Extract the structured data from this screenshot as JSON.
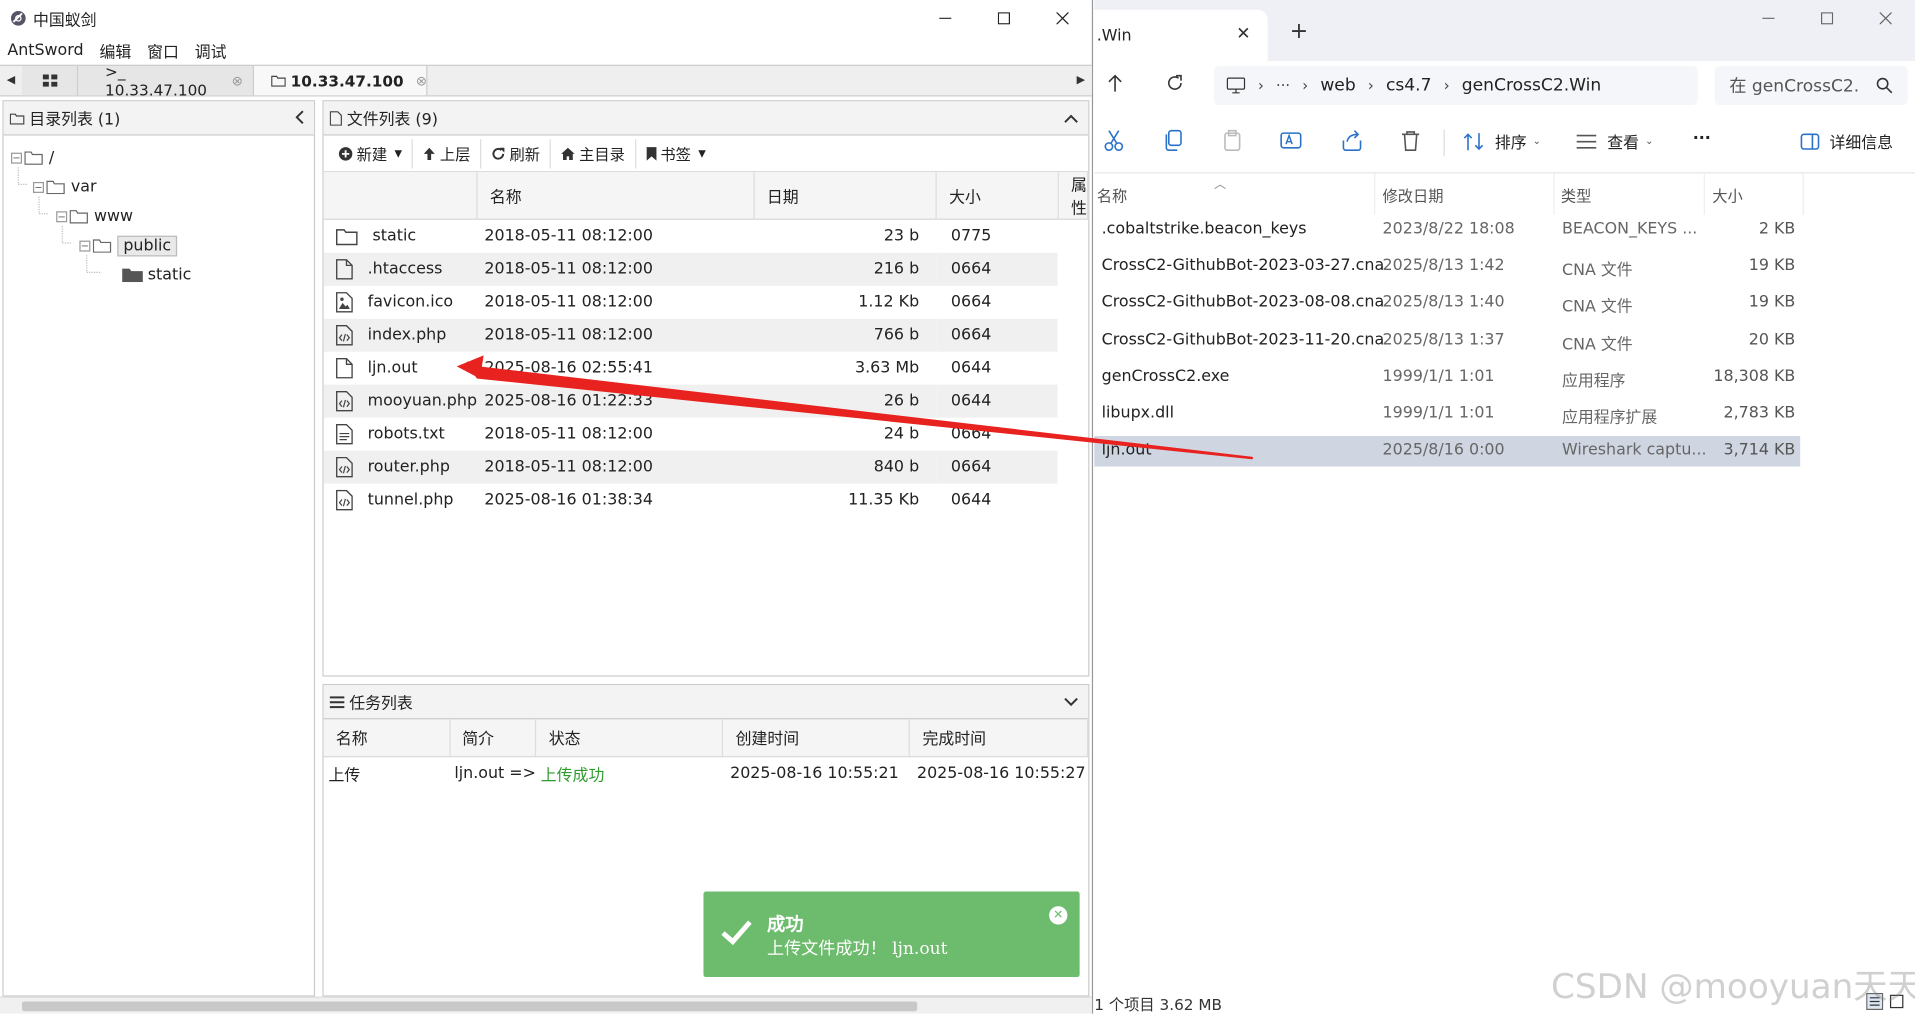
{
  "antsword": {
    "window_title": "中国蚁剑",
    "menu": [
      "AntSword",
      "编辑",
      "窗口",
      "调试"
    ],
    "tabs": [
      {
        "label": ">_ 10.33.47.100"
      },
      {
        "label": "10.33.47.100"
      }
    ],
    "dir_panel_title": "目录列表 (1)",
    "tree": [
      "/",
      "var",
      "www",
      "public",
      "static"
    ],
    "file_panel_title": "文件列表 (9)",
    "toolbar": {
      "new": "新建",
      "up": "上层",
      "refresh": "刷新",
      "home": "主目录",
      "bookmark": "书签"
    },
    "file_columns": [
      "名称",
      "日期",
      "大小",
      "属性"
    ],
    "files": [
      {
        "icon": "folder",
        "name": "static",
        "date": "2018-05-11 08:12:00",
        "size": "23 b",
        "perm": "0775"
      },
      {
        "icon": "file",
        "name": ".htaccess",
        "date": "2018-05-11 08:12:00",
        "size": "216 b",
        "perm": "0664"
      },
      {
        "icon": "image",
        "name": "favicon.ico",
        "date": "2018-05-11 08:12:00",
        "size": "1.12 Kb",
        "perm": "0664"
      },
      {
        "icon": "code",
        "name": "index.php",
        "date": "2018-05-11 08:12:00",
        "size": "766 b",
        "perm": "0664"
      },
      {
        "icon": "file",
        "name": "ljn.out",
        "date": "2025-08-16 02:55:41",
        "size": "3.63 Mb",
        "perm": "0644"
      },
      {
        "icon": "code",
        "name": "mooyuan.php",
        "date": "2025-08-16 01:22:33",
        "size": "26 b",
        "perm": "0644"
      },
      {
        "icon": "text",
        "name": "robots.txt",
        "date": "2018-05-11 08:12:00",
        "size": "24 b",
        "perm": "0664"
      },
      {
        "icon": "code",
        "name": "router.php",
        "date": "2018-05-11 08:12:00",
        "size": "840 b",
        "perm": "0664"
      },
      {
        "icon": "code",
        "name": "tunnel.php",
        "date": "2025-08-16 01:38:34",
        "size": "11.35 Kb",
        "perm": "0644"
      }
    ],
    "task_panel_title": "任务列表",
    "task_columns": [
      "名称",
      "简介",
      "状态",
      "创建时间",
      "完成时间"
    ],
    "tasks": [
      {
        "name": "上传",
        "desc": "ljn.out =>",
        "status": "上传成功",
        "created": "2025-08-16 10:55:21",
        "finished": "2025-08-16 10:55:27"
      }
    ],
    "toast": {
      "title": "成功",
      "message": "上传文件成功！ ljn.out"
    }
  },
  "explorer": {
    "tab_title": ".Win",
    "path": [
      "web",
      "cs4.7",
      "genCrossC2.Win"
    ],
    "search_placeholder": "在 genCrossC2.",
    "commands": {
      "sort": "排序",
      "view": "查看",
      "more": "···",
      "details": "详细信息"
    },
    "columns": [
      "名称",
      "修改日期",
      "类型",
      "大小"
    ],
    "files": [
      {
        "name": ".cobaltstrike.beacon_keys",
        "date": "2023/8/22 18:08",
        "type": "BEACON_KEYS ...",
        "size": "2 KB"
      },
      {
        "name": "CrossC2-GithubBot-2023-03-27.cna",
        "date": "2025/8/13 1:42",
        "type": "CNA 文件",
        "size": "19 KB"
      },
      {
        "name": "CrossC2-GithubBot-2023-08-08.cna",
        "date": "2025/8/13 1:40",
        "type": "CNA 文件",
        "size": "19 KB"
      },
      {
        "name": "CrossC2-GithubBot-2023-11-20.cna",
        "date": "2025/8/13 1:37",
        "type": "CNA 文件",
        "size": "20 KB"
      },
      {
        "name": "genCrossC2.exe",
        "date": "1999/1/1 1:01",
        "type": "应用程序",
        "size": "18,308 KB"
      },
      {
        "name": "libupx.dll",
        "date": "1999/1/1 1:01",
        "type": "应用程序扩展",
        "size": "2,783 KB"
      },
      {
        "name": "ljn.out",
        "date": "2025/8/16 0:00",
        "type": "Wireshark captu...",
        "size": "3,714 KB"
      }
    ],
    "selected_index": 6,
    "status": "1 个项目  3.62 MB"
  },
  "watermark": "CSDN @mooyuan天天",
  "colors": {
    "toast_bg": "#6dbb6d",
    "arrow": "#e8231f",
    "success_text": "#2e9b2e",
    "selection": "#cfd6e2"
  }
}
